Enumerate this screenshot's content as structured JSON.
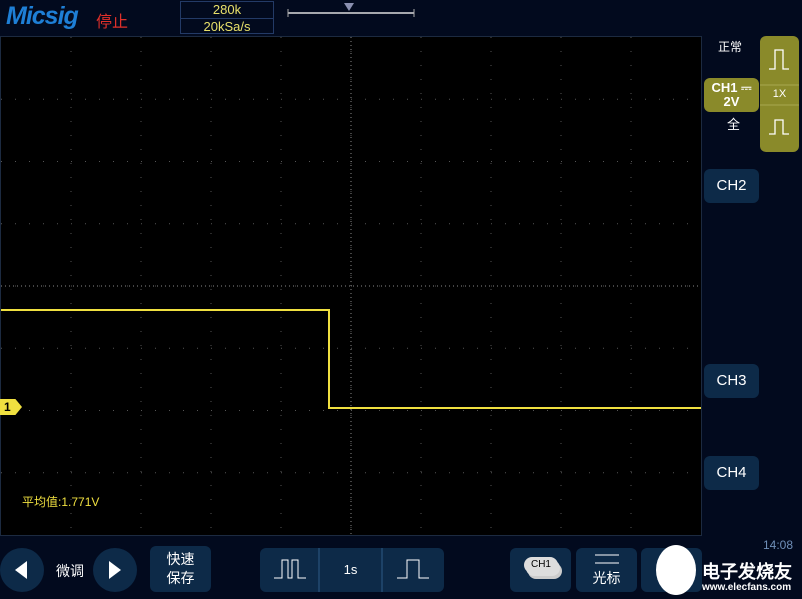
{
  "header": {
    "logo": "Micsig",
    "status": "停止",
    "memory_depth": "280k",
    "sample_rate": "20kSa/s"
  },
  "right_panel": {
    "trigger_mode": "正常",
    "ch1_label": "CH1",
    "ch1_scale": "2V",
    "ch1_coupling": "⎓",
    "bandwidth": "全",
    "probe": "1X",
    "ch2": "CH2",
    "ch3": "CH3",
    "ch4": "CH4"
  },
  "plot": {
    "channel_marker": "1",
    "measurement": "平均值:1.771V",
    "colors": {
      "ch1": "#f0e040"
    }
  },
  "bottom": {
    "fine_tune": "微调",
    "quick_save_line1": "快速",
    "quick_save_line2": "保存",
    "timebase": "1s",
    "ch_select": "CH1",
    "cursor": "光标",
    "time": "14:08"
  },
  "watermark": {
    "text": "电子发烧友",
    "url": "www.elecfans.com"
  }
}
